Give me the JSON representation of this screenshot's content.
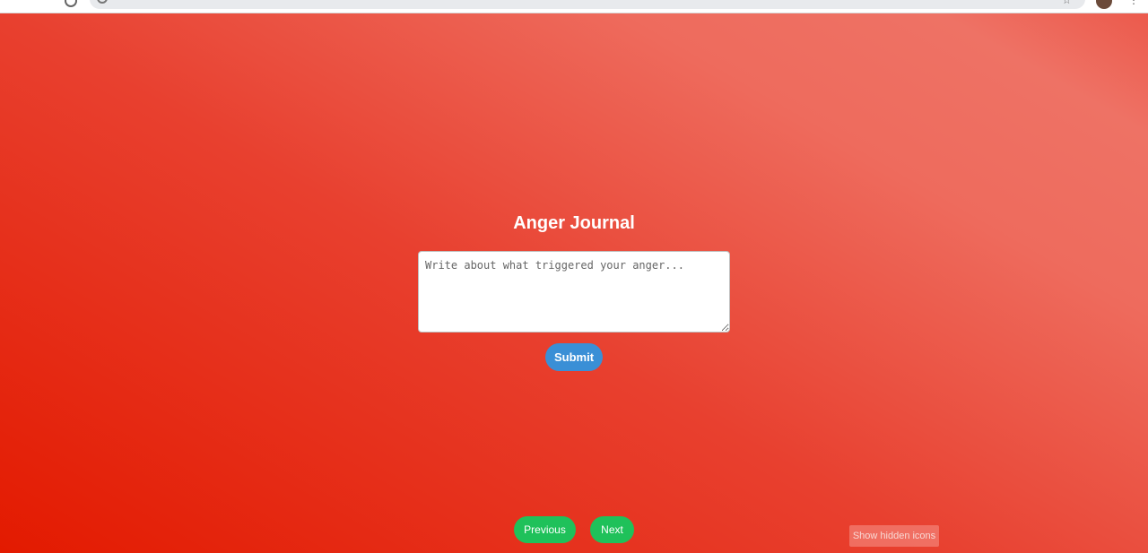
{
  "browser": {
    "address_text": "",
    "star_icon": "☆",
    "menu_icon": "⋮"
  },
  "journal": {
    "title": "Anger Journal",
    "placeholder": "Write about what triggered your anger...",
    "value": "",
    "submit_label": "Submit"
  },
  "navigation": {
    "previous_label": "Previous",
    "next_label": "Next"
  },
  "system": {
    "tooltip": "Show hidden icons"
  },
  "colors": {
    "background_start": "#e31a00",
    "background_end": "#ee7265",
    "submit_button": "#3a8fd6",
    "nav_button": "#1fc15a",
    "text": "#ffffff"
  }
}
